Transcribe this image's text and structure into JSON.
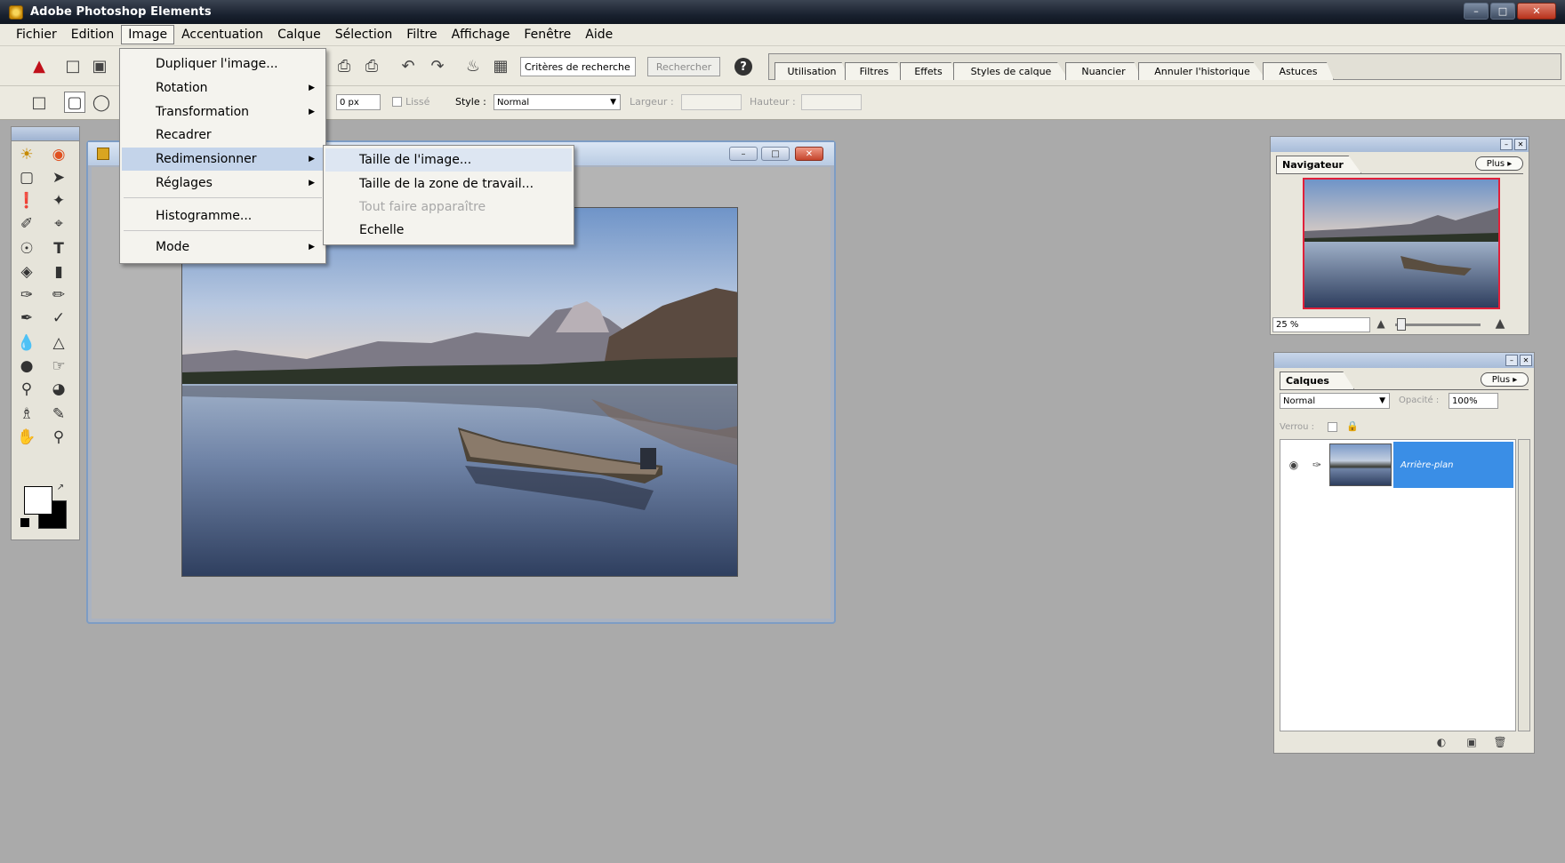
{
  "window": {
    "title": "Adobe Photoshop Elements",
    "controls": [
      "minimize-icon",
      "maximize-icon",
      "close-icon"
    ]
  },
  "menubar": {
    "items": [
      "Fichier",
      "Edition",
      "Image",
      "Accentuation",
      "Calque",
      "Sélection",
      "Filtre",
      "Affichage",
      "Fenêtre",
      "Aide"
    ],
    "open": "Image"
  },
  "toolbar": {
    "search_value": "Critères de recherche",
    "search_button": "Rechercher",
    "help_label": "?",
    "palette_tabs": [
      "Utilisation",
      "Filtres",
      "Effets",
      "Styles de calque",
      "Nuancier",
      "Annuler l'historique",
      "Astuces"
    ]
  },
  "options": {
    "feather_value": "0 px",
    "lisse_label": "Lissé",
    "style_label": "Style :",
    "style_value": "Normal",
    "largeur_label": "Largeur :",
    "hauteur_label": "Hauteur :"
  },
  "image_menu": {
    "items": [
      {
        "label": "Dupliquer l'image...",
        "submenu": false
      },
      {
        "label": "Rotation",
        "submenu": true
      },
      {
        "label": "Transformation",
        "submenu": true
      },
      {
        "label": "Recadrer",
        "submenu": false
      },
      {
        "label": "Redimensionner",
        "submenu": true
      },
      {
        "label": "Réglages",
        "submenu": true
      },
      {
        "label": "Histogramme...",
        "submenu": false
      },
      {
        "label": "Mode",
        "submenu": true
      }
    ],
    "highlighted": "Redimensionner"
  },
  "resize_submenu": {
    "items": [
      {
        "label": "Taille de l'image...",
        "enabled": true
      },
      {
        "label": "Taille de la zone de travail...",
        "enabled": true
      },
      {
        "label": "Tout faire apparaître",
        "enabled": false
      },
      {
        "label": "Echelle",
        "enabled": true
      }
    ],
    "highlighted": "Taille de l'image..."
  },
  "navigator": {
    "tab_label": "Navigateur",
    "more_label": "Plus ▸",
    "zoom_value": "25 %"
  },
  "layers": {
    "tab_label": "Calques",
    "more_label": "Plus ▸",
    "blend_mode": "Normal",
    "opacity_label": "Opacité :",
    "opacity_value": "100%",
    "lock_label": "Verrou :",
    "layer_name": "Arrière-plan"
  },
  "colors": {
    "workspace": "#aaaaaa",
    "title_bar": "#1a2230",
    "menu_bg": "#eceae0",
    "selection": "#3a8ee6",
    "nav_frame": "#e0203a"
  }
}
